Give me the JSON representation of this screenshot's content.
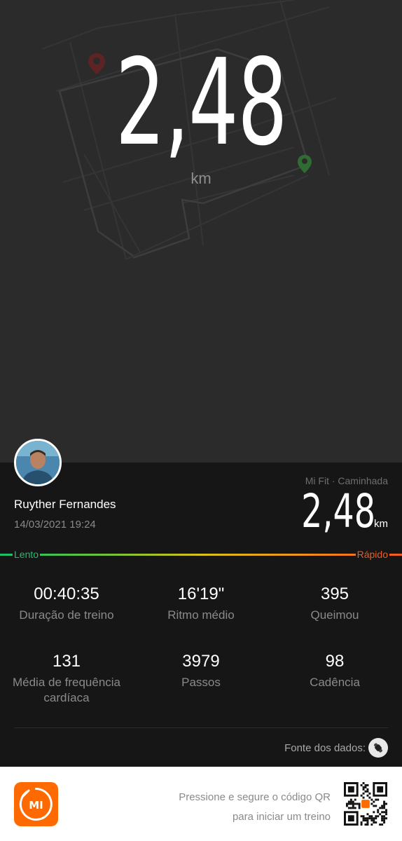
{
  "hero": {
    "distance": "2,48",
    "unit": "km"
  },
  "map": {
    "start_pin_color": "#2e7d32",
    "end_pin_color": "#8b1e1e"
  },
  "user": {
    "name": "Ruyther Fernandes",
    "datetime": "14/03/2021 19:24"
  },
  "summary": {
    "source_label": "Mi Fit · Caminhada",
    "distance": "2,48",
    "unit": "km"
  },
  "speed_scale": {
    "slow_label": "Lento",
    "fast_label": "Rápido",
    "colors": [
      "#16c06b",
      "#d9c11a",
      "#f25a1e"
    ]
  },
  "stats": [
    {
      "value": "00:40:35",
      "label": "Duração de treino"
    },
    {
      "value": "16'19\"",
      "label": "Ritmo médio"
    },
    {
      "value": "395",
      "label": "Queimou"
    },
    {
      "value": "131",
      "label": "Média de frequência cardíaca"
    },
    {
      "value": "3979",
      "label": "Passos"
    },
    {
      "value": "98",
      "label": "Cadência"
    }
  ],
  "data_source": {
    "label": "Fonte dos dados:",
    "icon": "watch-icon"
  },
  "footer": {
    "logo_text": "MI",
    "logo_color": "#ff6a00",
    "line1": "Pressione e segure o código QR",
    "line2": "para iniciar um treino"
  }
}
